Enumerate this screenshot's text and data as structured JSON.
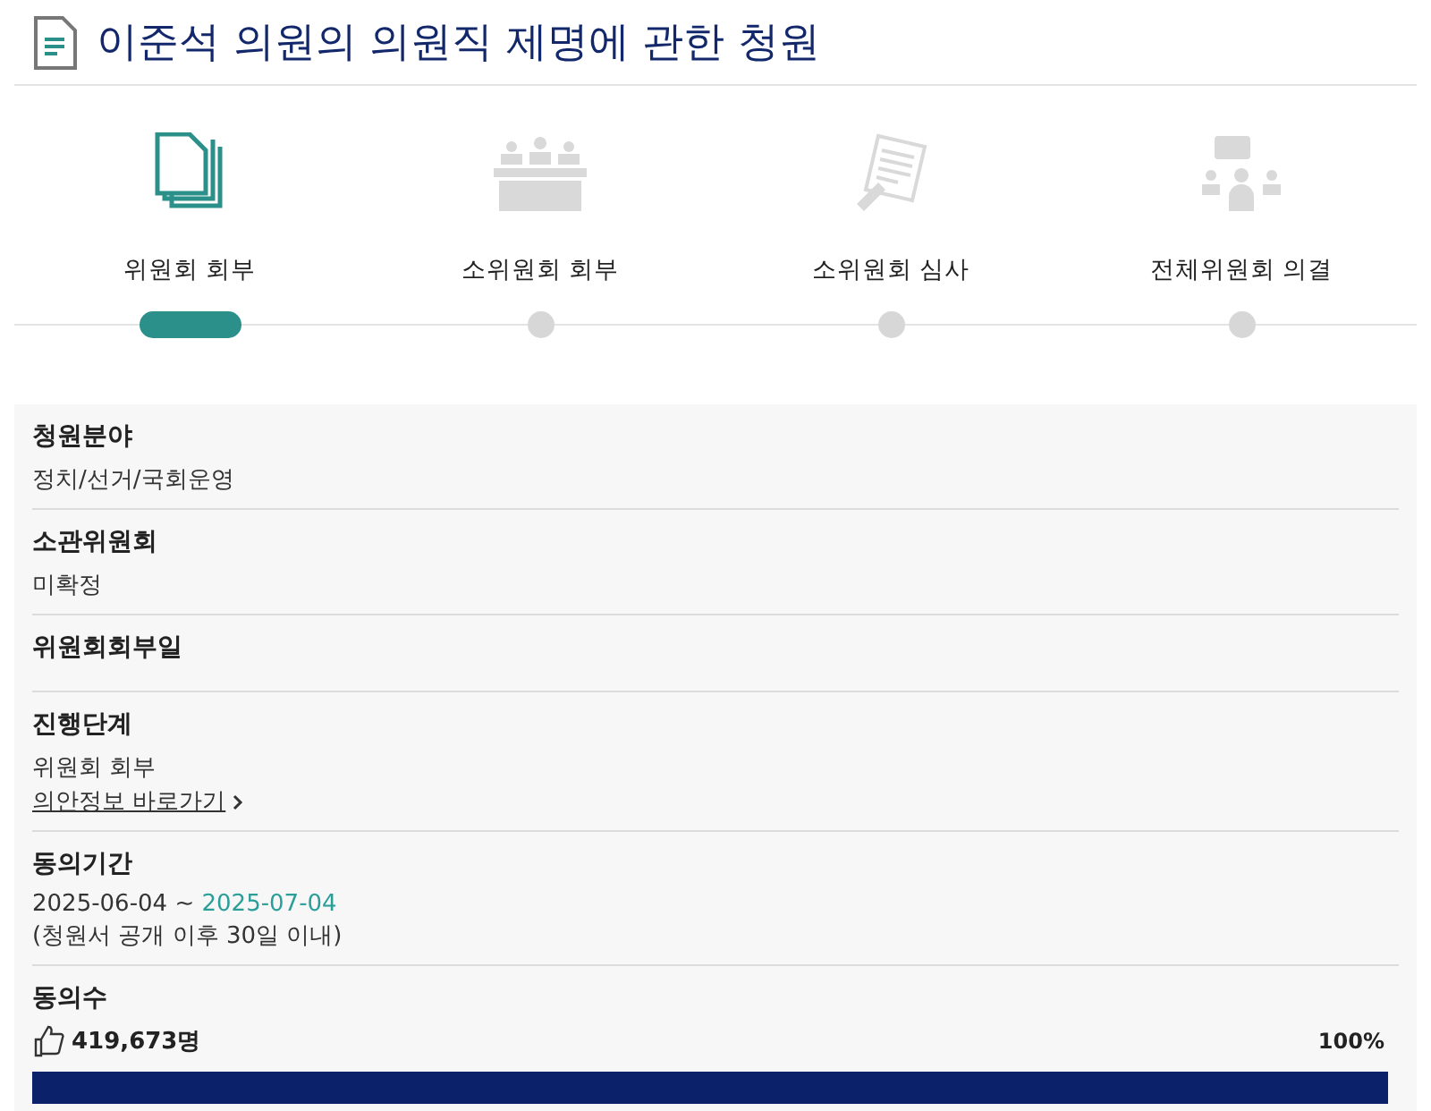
{
  "title": "이준석 의원의 의원직 제명에 관한 청원",
  "steps": [
    {
      "label": "위원회 회부",
      "selected": true
    },
    {
      "label": "소위원회 회부",
      "selected": false
    },
    {
      "label": "소위원회 심사",
      "selected": false
    },
    {
      "label": "전체위원회 의결",
      "selected": false
    }
  ],
  "fields": [
    {
      "kind": "text",
      "label": "청원분야",
      "value": "정치/선거/국회운영"
    },
    {
      "kind": "text",
      "label": "소관위원회",
      "value": "미확정"
    },
    {
      "kind": "empty",
      "label": "위원회회부일"
    },
    {
      "kind": "stage",
      "label": "진행단계",
      "value": "위원회 회부",
      "link": "의안정보 바로가기"
    },
    {
      "kind": "period",
      "label": "동의기간",
      "start": "2025-06-04",
      "separator": "~",
      "end": "2025-07-04",
      "note": "(청원서 공개 이후 30일 이내)"
    },
    {
      "kind": "count",
      "label": "동의수",
      "count": "419,673명",
      "percent": "100%",
      "level": 1
    }
  ]
}
